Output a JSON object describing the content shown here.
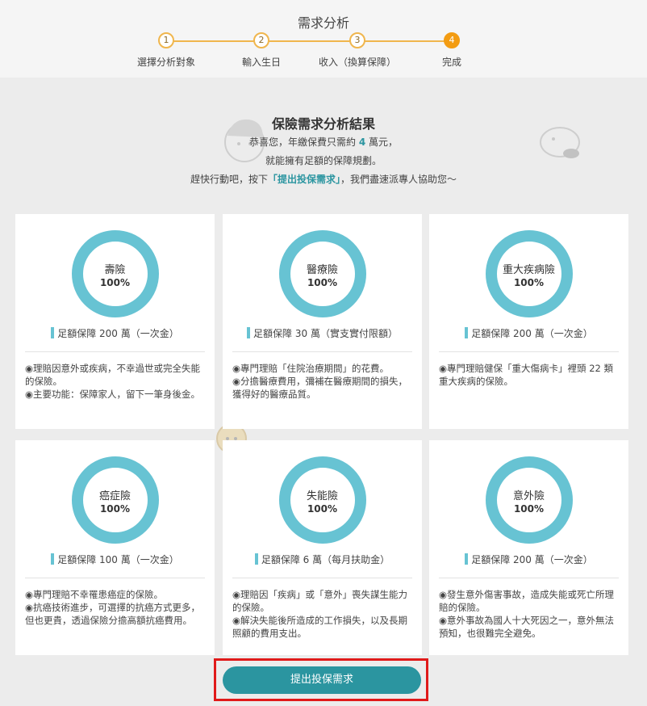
{
  "header": {
    "title": "需求分析",
    "steps": [
      {
        "num": "1",
        "label": "選擇分析對象"
      },
      {
        "num": "2",
        "label": "輸入生日"
      },
      {
        "num": "3",
        "label": "收入（換算保障）"
      },
      {
        "num": "4",
        "label": "完成"
      }
    ],
    "current_step": 4
  },
  "result": {
    "title": "保險需求分析結果",
    "line1_pre": "恭喜您，年繳保費只需約 ",
    "line1_num": "4",
    "line1_post": " 萬元，",
    "line2": "就能擁有足額的保障規劃。",
    "line3_pre": "趕快行動吧，按下",
    "line3_link": "「提出投保需求」",
    "line3_post": "，我們盡速派專人協助您～"
  },
  "cards": [
    {
      "name": "壽險",
      "percent": "100%",
      "amount": "足額保障 200 萬（一次金）",
      "desc": [
        "◉理賠因意外或疾病，不幸過世或完全失能的保險。",
        "◉主要功能：保障家人，留下一筆身後金。"
      ]
    },
    {
      "name": "醫療險",
      "percent": "100%",
      "amount": "足額保障 30 萬（實支實付限額）",
      "desc": [
        "◉專門理賠「住院治療期間」的花費。",
        "◉分擔醫療費用，彌補在醫療期間的損失，獲得好的醫療品質。"
      ]
    },
    {
      "name": "重大疾病險",
      "percent": "100%",
      "amount": "足額保障 200 萬（一次金）",
      "desc": [
        "◉專門理賠健保「重大傷病卡」裡頭 22 類重大疾病的保險。"
      ]
    },
    {
      "name": "癌症險",
      "percent": "100%",
      "amount": "足額保障 100 萬（一次金）",
      "desc": [
        "◉專門理賠不幸罹患癌症的保險。",
        "◉抗癌技術進步，可選擇的抗癌方式更多，但也更貴，透過保險分擔高額抗癌費用。"
      ]
    },
    {
      "name": "失能險",
      "percent": "100%",
      "amount": "足額保障 6 萬（每月扶助金）",
      "desc": [
        "◉理賠因「疾病」或「意外」喪失謀生能力的保險。",
        "◉解決失能後所造成的工作損失，以及長期照顧的費用支出。"
      ]
    },
    {
      "name": "意外險",
      "percent": "100%",
      "amount": "足額保障 200 萬（一次金）",
      "desc": [
        "◉發生意外傷害事故，造成失能或死亡所理賠的保險。",
        "◉意外事故為國人十大死因之一，意外無法預知，也很難完全避免。"
      ]
    }
  ],
  "cta": {
    "label": "提出投保需求"
  },
  "colors": {
    "accent": "#2b95a0",
    "ring": "#67c3d3",
    "step": "#f39c12",
    "highlight_box": "#e01a1a"
  }
}
